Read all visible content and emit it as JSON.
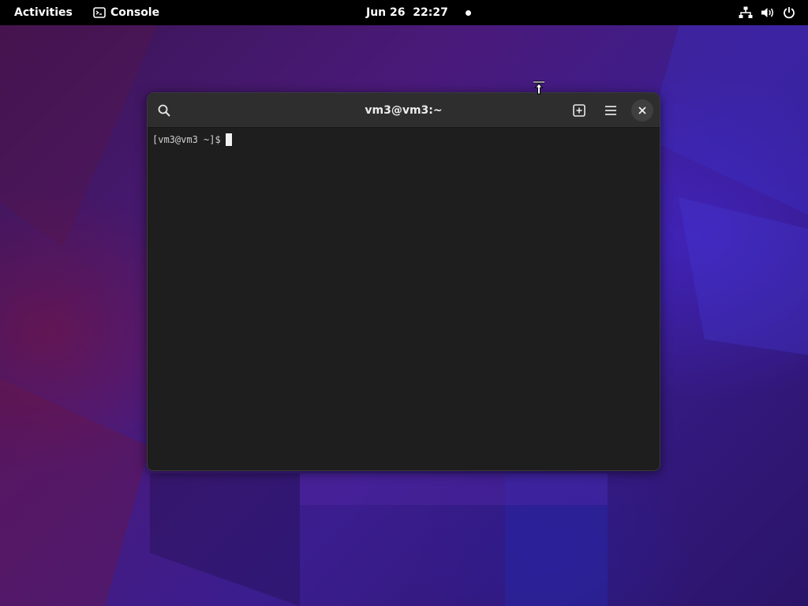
{
  "topbar": {
    "activities_label": "Activities",
    "app_name": "Console",
    "clock_text": "Jun 26  22:27"
  },
  "window": {
    "title": "vm3@vm3:~"
  },
  "terminal": {
    "prompt": "[vm3@vm3 ~]$"
  },
  "colors": {
    "topbar_bg": "#000000",
    "window_header_bg": "#2e2e2e",
    "terminal_bg": "#1e1e1e",
    "wallpaper_accent": "#4a1a7a"
  },
  "icons": {
    "app_menu": "terminal-icon",
    "tray": [
      "network-icon",
      "volume-icon",
      "power-icon"
    ],
    "header": [
      "search-icon",
      "new-tab-icon",
      "hamburger-menu-icon",
      "close-icon"
    ],
    "pointer": "resize-top-cursor-icon"
  }
}
